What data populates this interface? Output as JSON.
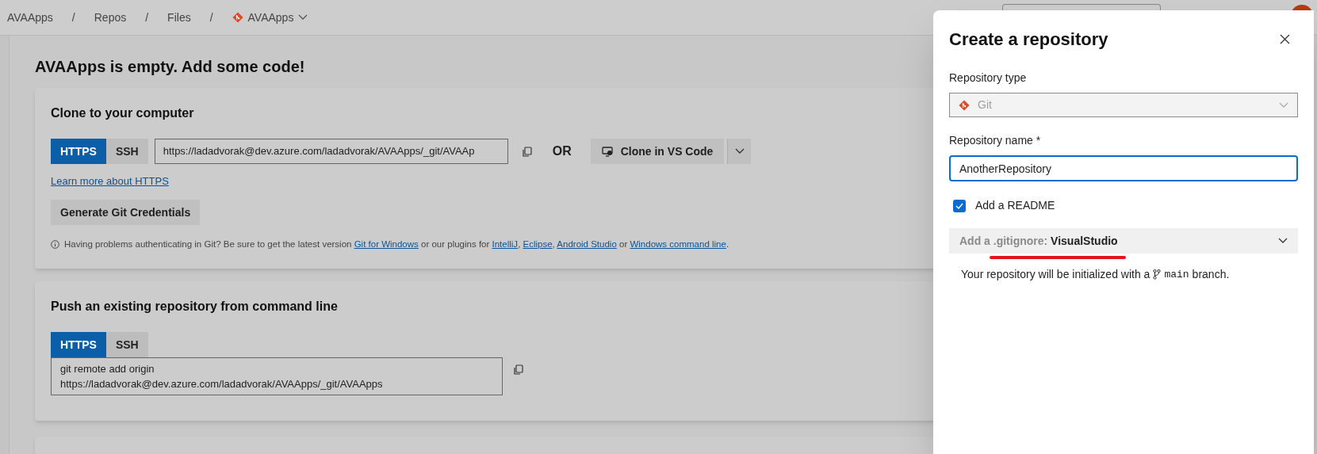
{
  "breadcrumb": [
    {
      "label": "AVAApps",
      "kind": "text"
    },
    {
      "label": "/",
      "kind": "separator"
    },
    {
      "label": "Repos",
      "kind": "text"
    },
    {
      "label": "/",
      "kind": "separator"
    },
    {
      "label": "Files",
      "kind": "text"
    },
    {
      "label": "/",
      "kind": "separator"
    },
    {
      "label": "AVAApps",
      "kind": "repo"
    }
  ],
  "page_title": "AVAApps is empty. Add some code!",
  "clone_card": {
    "title": "Clone to your computer",
    "tabs": [
      {
        "label": "HTTPS",
        "selected": true
      },
      {
        "label": "SSH",
        "selected": false
      }
    ],
    "url": "https://ladadvorak@dev.azure.com/ladadvorak/AVAApps/_git/AVAAp",
    "or_label": "OR",
    "clone_button": "Clone in VS Code",
    "learn_link": "Learn more about HTTPS",
    "generate_button": "Generate Git Credentials",
    "help": [
      {
        "text": "Having problems authenticating in Git? Be sure to get the latest version ",
        "link": false
      },
      {
        "text": "Git for Windows",
        "link": true
      },
      {
        "text": " or our plugins for ",
        "link": false
      },
      {
        "text": "IntelliJ",
        "link": true
      },
      {
        "text": ", ",
        "link": false
      },
      {
        "text": "Eclipse",
        "link": true
      },
      {
        "text": ", ",
        "link": false
      },
      {
        "text": "Android Studio",
        "link": true
      },
      {
        "text": " or ",
        "link": false
      },
      {
        "text": "Windows command line",
        "link": true
      },
      {
        "text": ".",
        "link": false
      }
    ]
  },
  "push_card": {
    "title": "Push an existing repository from command line",
    "tabs": [
      {
        "label": "HTTPS",
        "selected": true
      },
      {
        "label": "SSH",
        "selected": false
      }
    ],
    "command_lines": [
      "git remote add origin",
      "https://ladadvorak@dev.azure.com/ladadvorak/AVAApps/_git/AVAApps"
    ]
  },
  "dialog": {
    "title": "Create a repository",
    "type_label": "Repository type",
    "type_value": "Git",
    "type_disabled": true,
    "name_label": "Repository name *",
    "name_value": "AnotherRepository",
    "readme": {
      "label": "Add a README",
      "checked": true
    },
    "gitignore": "Add a .gitignore: **VisualStudio**",
    "info_text": "Your repository will be initialized with a",
    "branch": "main",
    "info_suffix": "branch."
  }
}
